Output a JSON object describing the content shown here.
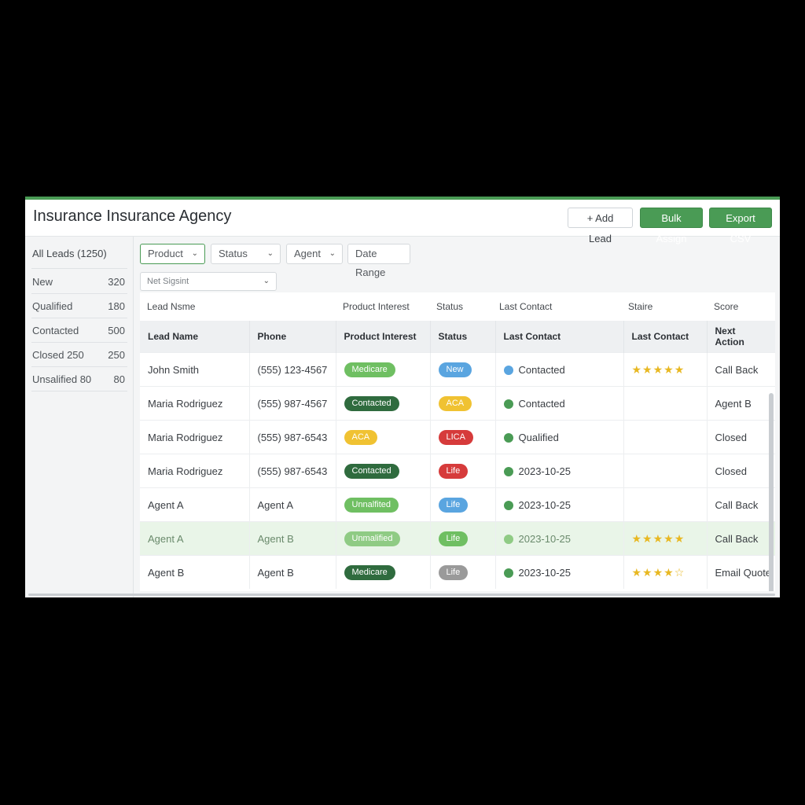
{
  "app": {
    "title": "Insurance Insurance Agency",
    "accent_color": "#4a9b55",
    "buttons": {
      "add_lead": "+ Add Lead",
      "bulk_assign": "Bulk Assign",
      "export_csv": "Export CSV"
    }
  },
  "sidebar": {
    "header": "All Leads (1250)",
    "items": [
      {
        "label": "New",
        "count": "320"
      },
      {
        "label": "Qualified",
        "count": "180"
      },
      {
        "label": "Contacted",
        "count": "500"
      },
      {
        "label": "Closed 250",
        "count": "250"
      },
      {
        "label": "Unsalified 80",
        "count": "80"
      }
    ]
  },
  "filters": {
    "product": "Product",
    "status": "Status",
    "agent": "Agent",
    "date_range": "Date Range",
    "search_placeholder": "Net Sigsint"
  },
  "ghost_header": [
    "Lead Nsme",
    "Product Interest",
    "Status",
    "Last Contact",
    "Staire",
    "Score"
  ],
  "table": {
    "columns": [
      "Lead Name",
      "Phone",
      "Product Interest",
      "Status",
      "Last Contact",
      "Last Contact",
      "Next Action"
    ],
    "rows": [
      {
        "name": "John Smith",
        "phone": "(555) 123-4567",
        "product": "Medicare",
        "product_color": "#6fbf62",
        "status": "New",
        "status_color": "#5aa5e0",
        "dot_color": "#5aa5e0",
        "contact": "Contacted",
        "stars": "★★★★★",
        "action": "Call Back"
      },
      {
        "name": "Maria Rodriguez",
        "phone": "(555) 987-4567",
        "product": "Contacted",
        "product_color": "#2f6b3e",
        "status": "ACA",
        "status_color": "#f0c232",
        "dot_color": "#4a9b55",
        "contact": "Contacted",
        "stars": "",
        "action": "Agent B"
      },
      {
        "name": "Maria Rodriguez",
        "phone": "(555) 987-6543",
        "product": "ACA",
        "product_color": "#f0c232",
        "status": "LICA",
        "status_color": "#d63b3b",
        "dot_color": "#4a9b55",
        "contact": "Qualified",
        "stars": "",
        "action": "Closed"
      },
      {
        "name": "Maria Rodriguez",
        "phone": "(555) 987-6543",
        "product": "Contacted",
        "product_color": "#2f6b3e",
        "status": "Life",
        "status_color": "#d63b3b",
        "dot_color": "#4a9b55",
        "contact": "2023-10-25",
        "stars": "",
        "action": "Closed"
      },
      {
        "name": "Agent A",
        "phone": "Agent A",
        "product": "Unnalfited",
        "product_color": "#6fbf62",
        "status": "Life",
        "status_color": "#5aa5e0",
        "dot_color": "#4a9b55",
        "contact": "2023-10-25",
        "stars": "",
        "action": "Call Back"
      },
      {
        "name": "Agent A",
        "phone": "Agent B",
        "product": "Unmalified",
        "product_color": "#8fcb84",
        "status": "Life",
        "status_color": "#6fbf62",
        "dot_color": "#8fcb84",
        "contact": "2023-10-25",
        "stars": "★★★★★",
        "action": "Call Back"
      },
      {
        "name": "Agent B",
        "phone": "Agent B",
        "product": "Medicare",
        "product_color": "#2f6b3e",
        "status": "Life",
        "status_color": "#9a9a9a",
        "dot_color": "#4a9b55",
        "contact": "2023-10-25",
        "stars": "★★★★☆",
        "action": "Email Quote"
      }
    ]
  }
}
